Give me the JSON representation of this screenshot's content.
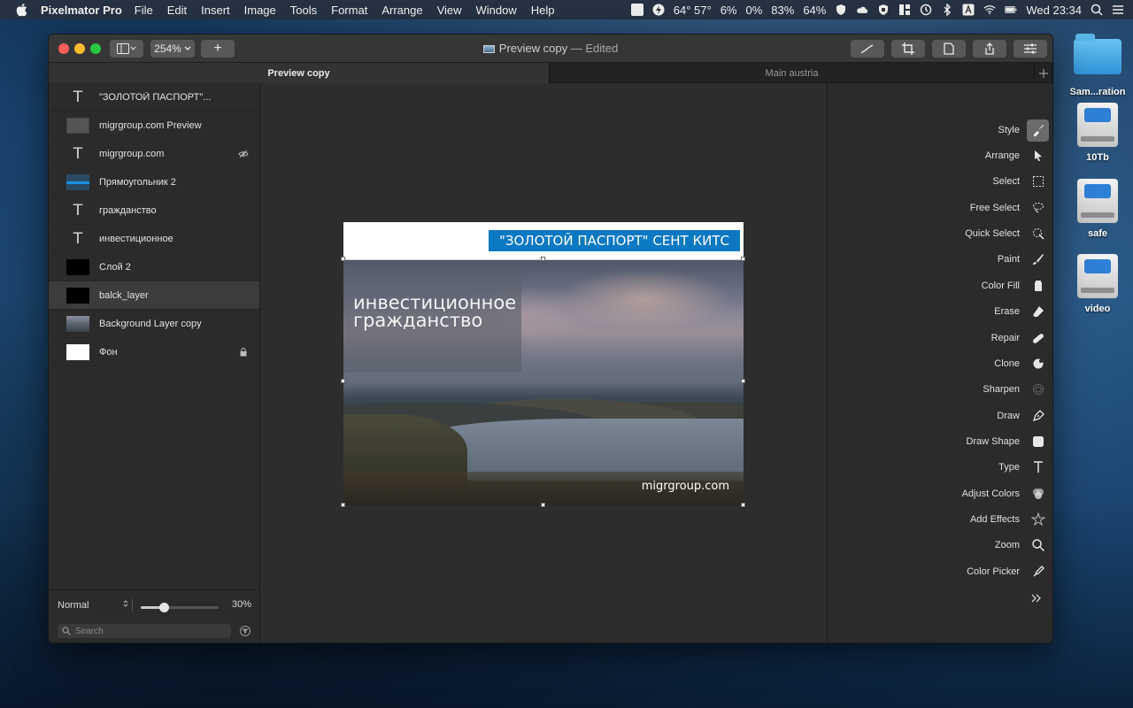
{
  "menubar": {
    "app_name": "Pixelmator Pro",
    "menus": [
      "File",
      "Edit",
      "Insert",
      "Image",
      "Tools",
      "Format",
      "Arrange",
      "View",
      "Window",
      "Help"
    ],
    "status": {
      "temps": "64° 57°",
      "cpu": "6%",
      "battery_a": "0%",
      "battery_b": "83%",
      "battery_c": "64%",
      "clock": "Wed 23:34"
    }
  },
  "window": {
    "title": "Preview copy",
    "title_suffix": "— Edited",
    "zoom_level": "254%",
    "add_label": "+"
  },
  "tabs": [
    {
      "label": "Preview copy",
      "active": true
    },
    {
      "label": "Main austria",
      "active": false
    }
  ],
  "layers": [
    {
      "name": "\"ЗОЛОТОЙ ПАСПОРТ\"...",
      "kind": "type"
    },
    {
      "name": "migrgroup.com Preview",
      "kind": "image-preview"
    },
    {
      "name": "migrgroup.com",
      "kind": "type",
      "badge": "hidden-eye-icon"
    },
    {
      "name": "Прямоугольник 2",
      "kind": "rect-blue"
    },
    {
      "name": "гражданство",
      "kind": "type"
    },
    {
      "name": "инвестиционное",
      "kind": "type"
    },
    {
      "name": "Слой 2",
      "kind": "black"
    },
    {
      "name": "balck_layer",
      "kind": "black",
      "selected": true
    },
    {
      "name": "Background Layer copy",
      "kind": "photo"
    },
    {
      "name": "Фон",
      "kind": "white",
      "badge": "lock-icon"
    }
  ],
  "layers_footer": {
    "blend_mode": "Normal",
    "opacity": "30%",
    "opacity_fraction": 0.3,
    "search_placeholder": "Search"
  },
  "canvas": {
    "banner_text": "\"ЗОЛОТОЙ ПАСПОРТ\" СЕНТ КИТС",
    "headline_line1": "инвестиционное",
    "headline_line2": "гражданство",
    "watermark": "migrgroup.com",
    "banner_color": "#0a78c2"
  },
  "tools": [
    {
      "label": "Style",
      "icon": "style-brush-icon",
      "active": true
    },
    {
      "label": "Arrange",
      "icon": "arrow-pointer-icon"
    },
    {
      "label": "Select",
      "icon": "marquee-select-icon"
    },
    {
      "label": "Free Select",
      "icon": "lasso-icon"
    },
    {
      "label": "Quick Select",
      "icon": "quick-select-icon"
    },
    {
      "label": "Paint",
      "icon": "paint-brush-icon"
    },
    {
      "label": "Color Fill",
      "icon": "paint-bucket-icon"
    },
    {
      "label": "Erase",
      "icon": "eraser-icon"
    },
    {
      "label": "Repair",
      "icon": "bandage-icon"
    },
    {
      "label": "Clone",
      "icon": "clone-stamp-icon"
    },
    {
      "label": "Sharpen",
      "icon": "sharpen-icon"
    },
    {
      "label": "Draw",
      "icon": "pen-nib-icon"
    },
    {
      "label": "Draw Shape",
      "icon": "shape-icon"
    },
    {
      "label": "Type",
      "icon": "type-icon"
    },
    {
      "label": "Adjust Colors",
      "icon": "adjust-colors-icon"
    },
    {
      "label": "Add Effects",
      "icon": "effects-star-icon"
    },
    {
      "label": "Zoom",
      "icon": "magnifier-icon"
    },
    {
      "label": "Color Picker",
      "icon": "eyedropper-icon"
    }
  ],
  "desktop_icons": [
    {
      "label": "Sam...ration",
      "kind": "folder"
    },
    {
      "label": "10Tb",
      "kind": "drive"
    },
    {
      "label": "safe",
      "kind": "drive"
    },
    {
      "label": "video",
      "kind": "drive"
    }
  ]
}
